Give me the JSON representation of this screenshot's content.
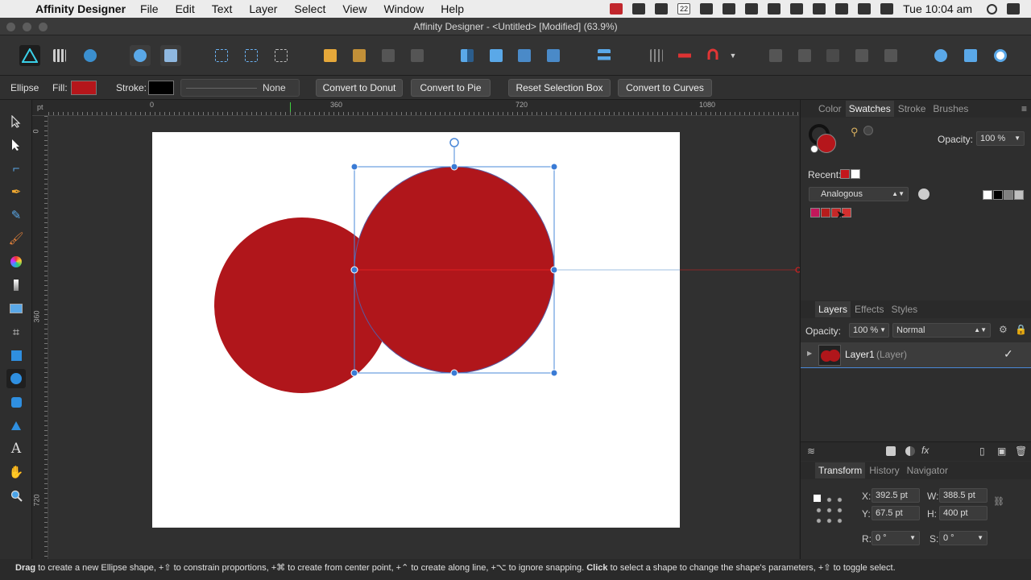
{
  "menubar": {
    "app_name": "Affinity Designer",
    "items": [
      "File",
      "Edit",
      "Text",
      "Layer",
      "Select",
      "View",
      "Window",
      "Help"
    ],
    "calendar_day": "22",
    "clock": "Tue 10:04 am"
  },
  "window": {
    "title": "Affinity Designer - <Untitled> [Modified] (63.9%)"
  },
  "context_bar": {
    "tool_name": "Ellipse",
    "fill_label": "Fill:",
    "fill_color": "#b5161b",
    "stroke_label": "Stroke:",
    "stroke_color": "#000000",
    "stroke_style": "None",
    "buttons": [
      "Convert to Donut",
      "Convert to Pie",
      "Reset Selection Box",
      "Convert to Curves"
    ]
  },
  "ruler": {
    "unit": "pt",
    "h_ticks": [
      "0",
      "360",
      "720",
      "1080"
    ],
    "v_ticks": [
      "0",
      "360",
      "720"
    ]
  },
  "shapes": {
    "ellipse_color": "#b0161b",
    "selection_color": "#3a7bd5"
  },
  "color_panel": {
    "tabs": [
      "Color",
      "Swatches",
      "Stroke",
      "Brushes"
    ],
    "active_tab": "Swatches",
    "opacity_label": "Opacity:",
    "opacity_value": "100 %",
    "recent_label": "Recent:",
    "recent_colors": [
      "#c4161c",
      "#ffffff"
    ],
    "palette_name": "Analogous",
    "palette_colors": [
      "#c2185b",
      "#b71c1c",
      "#c62828",
      "#d32f2f"
    ],
    "grey_swatches": [
      "#000000",
      "#808080",
      "#c0c0c0",
      "#ffffff"
    ]
  },
  "layers_panel": {
    "tabs": [
      "Layers",
      "Effects",
      "Styles"
    ],
    "active_tab": "Layers",
    "opacity_label": "Opacity:",
    "opacity_value": "100 %",
    "blend_mode": "Normal",
    "layer_name": "Layer1",
    "layer_type": "(Layer)"
  },
  "transform_panel": {
    "tabs": [
      "Transform",
      "History",
      "Navigator"
    ],
    "active_tab": "Transform",
    "x_label": "X:",
    "x_value": "392.5 pt",
    "y_label": "Y:",
    "y_value": "67.5 pt",
    "w_label": "W:",
    "w_value": "388.5 pt",
    "h_label": "H:",
    "h_value": "400 pt",
    "r_label": "R:",
    "r_value": "0 °",
    "s_label": "S:",
    "s_value": "0 °"
  },
  "status_bar": {
    "w1": "Drag",
    "t1": " to create a new Ellipse shape, +⇧ to constrain proportions, +⌘ to create from center point, +⌃ to create along line, +⌥ to ignore snapping. ",
    "w2": "Click",
    "t2": " to select a shape to change the shape's parameters, +⇧ to toggle select."
  }
}
